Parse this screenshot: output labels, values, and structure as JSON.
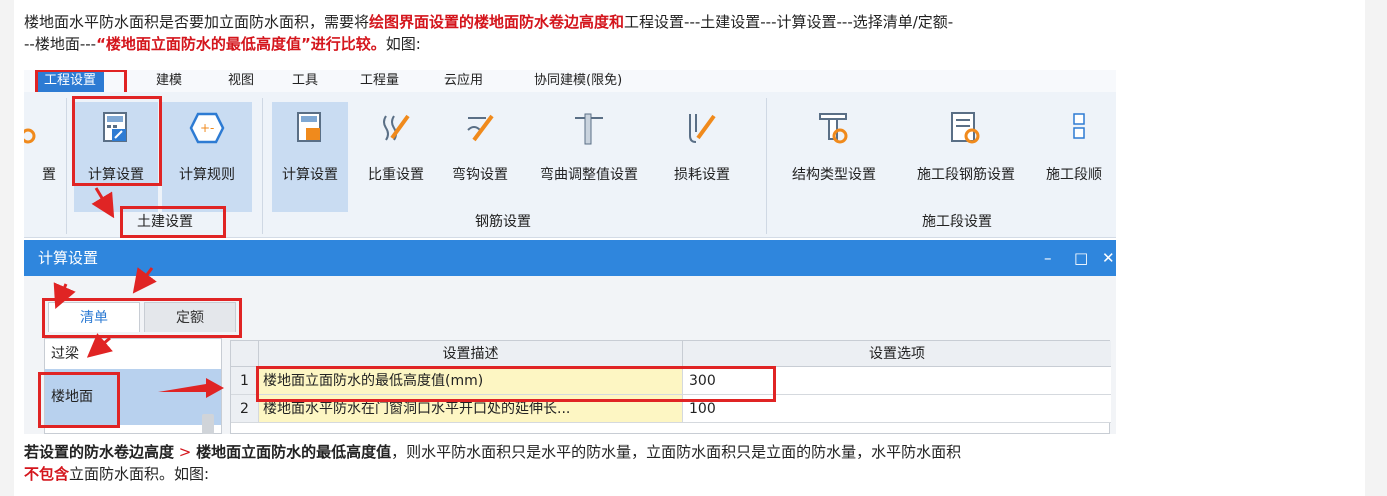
{
  "article": {
    "p1_a": "楼地面水平防水面积是否要加立面防水面积，需要将",
    "p1_b": "绘图界面设置的楼地面防水卷边高度和",
    "p1_c": "工程设置---土建设置---计算设置---选择清单/定额-",
    "p2_a": "--楼地面---",
    "p2_b": "“楼地面立面防水的最低高度值”进行比较。",
    "p2_c": "如图:",
    "p3_a": "若设置的防水卷边高度",
    "p3_b": " > ",
    "p3_c": "楼地面立面防水的最低高度值",
    "p3_d": "，则水平防水面积只是水平的防水量，立面防水面积只是立面的防水量，水平防水面积",
    "p4_a": "不包含",
    "p4_b": "立面防水面积。如图:"
  },
  "menu": {
    "items": [
      "工程设置",
      "建模",
      "视图",
      "工具",
      "工程量",
      "云应用",
      "协同建模(限免)"
    ]
  },
  "ribbon": {
    "partial_left": "置",
    "calc_settings": "计算设置",
    "calc_rules": "计算规则",
    "tujian_group": "土建设置",
    "rebar_buttons": [
      "计算设置",
      "比重设置",
      "弯钩设置",
      "弯曲调整值设置",
      "损耗设置"
    ],
    "rebar_group": "钢筋设置",
    "stage_buttons": [
      "结构类型设置",
      "施工段钢筋设置",
      "施工段顺"
    ],
    "stage_group": "施工段设置"
  },
  "dialog": {
    "title": "计算设置",
    "minimize": "–",
    "maximize": "□",
    "close": "✕",
    "tabs": [
      "清单",
      "定额"
    ],
    "list": [
      "过梁",
      "楼地面"
    ],
    "headers": [
      "设置描述",
      "设置选项"
    ],
    "rows": [
      {
        "num": "1",
        "desc": "楼地面立面防水的最低高度值(mm)",
        "value": "300"
      },
      {
        "num": "2",
        "desc": "楼地面水平防水在门窗洞口水平开口处的延伸长...",
        "value": "100"
      }
    ]
  },
  "colors": {
    "accent": "#2f86dd",
    "highlight_red": "#e02424",
    "text_red": "#d4151c"
  }
}
